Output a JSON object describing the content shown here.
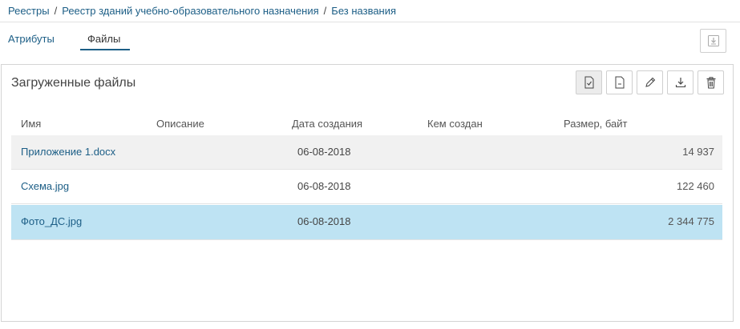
{
  "breadcrumb": {
    "items": [
      "Реестры",
      "Реестр зданий учебно-образовательного назначения",
      "Без названия"
    ],
    "separator": "/"
  },
  "tabs": [
    {
      "label": "Атрибуты",
      "active": false
    },
    {
      "label": "Файлы",
      "active": true
    }
  ],
  "panel": {
    "title": "Загруженные файлы",
    "toolbar": [
      "file-check-icon",
      "file-icon",
      "pencil-icon",
      "download-icon",
      "trash-icon"
    ]
  },
  "table": {
    "columns": [
      "Имя",
      "Описание",
      "Дата создания",
      "Кем создан",
      "Размер, байт"
    ],
    "rows": [
      {
        "name": "Приложение 1.docx",
        "description": "",
        "created": "06-08-2018",
        "author": "",
        "size": "14 937"
      },
      {
        "name": "Схема.jpg",
        "description": "",
        "created": "06-08-2018",
        "author": "",
        "size": "122 460"
      },
      {
        "name": "Фото_ДС.jpg",
        "description": "",
        "created": "06-08-2018",
        "author": "",
        "size": "2 344 775"
      }
    ],
    "selected_row": 2
  },
  "colors": {
    "link": "#1c5e86",
    "selected_row": "#bee3f3",
    "hover_row": "#f1f1f1"
  }
}
